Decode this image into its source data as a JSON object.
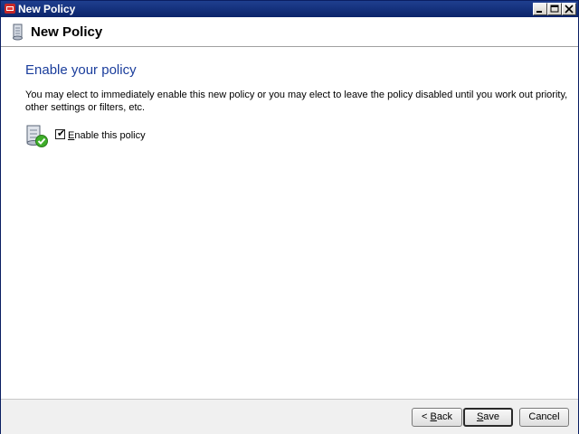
{
  "window": {
    "title": "New Policy",
    "controls": {
      "minimize": "_",
      "maximize": "□",
      "close": "×"
    }
  },
  "header": {
    "title": "New Policy",
    "icon": "policy-scroll-icon"
  },
  "content": {
    "section_title": "Enable your policy",
    "description": "You may elect to immediately enable this new policy or you may elect to leave the policy disabled until you work out priority, other settings or filters, etc.",
    "enable_checkbox": {
      "label_accel": "E",
      "label_rest": "nable this policy",
      "checked": true,
      "mark": "✔"
    },
    "icon": "enabled-policy-icon"
  },
  "footer": {
    "back": {
      "prefix": "< ",
      "accel": "B",
      "rest": "ack"
    },
    "save": {
      "accel": "S",
      "rest": "ave"
    },
    "cancel": {
      "label": "Cancel"
    }
  }
}
